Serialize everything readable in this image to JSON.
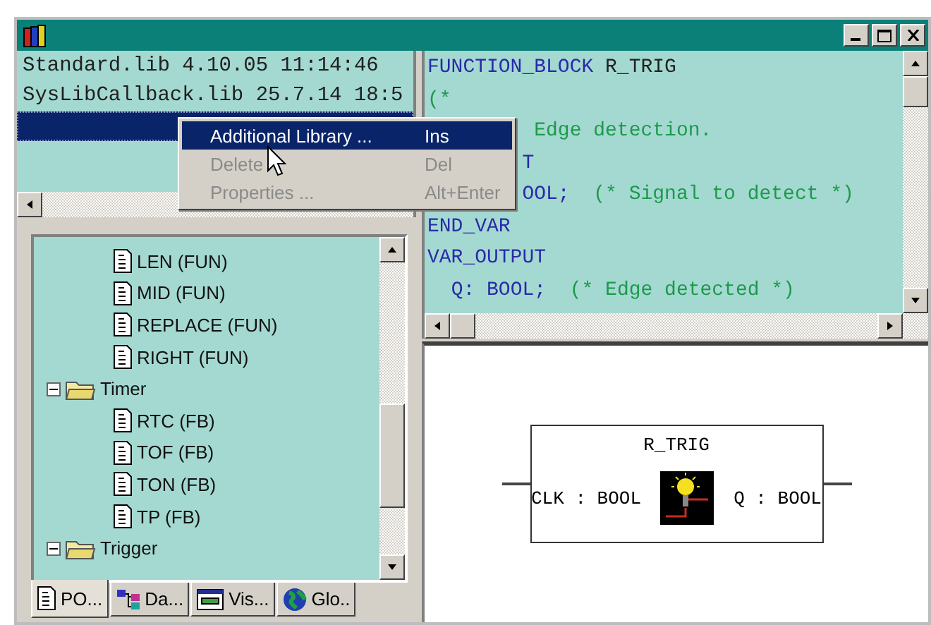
{
  "library_list": {
    "rows": [
      {
        "label": "Standard.lib 4.10.05 11:14:46",
        "selected": false
      },
      {
        "label": "SysLibCallback.lib 25.7.14 18:5",
        "selected": false
      },
      {
        "selected": true
      }
    ]
  },
  "context_menu": {
    "items": [
      {
        "label": "Additional Library ...",
        "shortcut": "Ins",
        "selected": true,
        "disabled": false
      },
      {
        "label": "Delete",
        "shortcut": "Del",
        "selected": false,
        "disabled": true
      },
      {
        "label": "Properties ...",
        "shortcut": "Alt+Enter",
        "selected": false,
        "disabled": true
      }
    ]
  },
  "tree": {
    "items": [
      {
        "label": "LEN (FUN)",
        "kind": "pou"
      },
      {
        "label": "MID (FUN)",
        "kind": "pou"
      },
      {
        "label": "REPLACE (FUN)",
        "kind": "pou"
      },
      {
        "label": "RIGHT (FUN)",
        "kind": "pou"
      },
      {
        "label": "Timer",
        "kind": "folder",
        "expanded": true,
        "children": [
          {
            "label": "RTC (FB)",
            "kind": "pou"
          },
          {
            "label": "TOF (FB)",
            "kind": "pou"
          },
          {
            "label": "TON (FB)",
            "kind": "pou"
          },
          {
            "label": "TP (FB)",
            "kind": "pou"
          }
        ]
      },
      {
        "label": "Trigger",
        "kind": "folder",
        "expanded": true
      }
    ]
  },
  "tabs": [
    {
      "label": "PO...",
      "kind": "pou",
      "selected": true
    },
    {
      "label": "Da...",
      "kind": "data",
      "selected": false
    },
    {
      "label": "Vis...",
      "kind": "vis",
      "selected": false
    },
    {
      "label": "Glo..",
      "kind": "globe",
      "selected": false
    }
  ],
  "code": {
    "lines": [
      [
        {
          "text": "FUNCTION_BLOCK",
          "kind": "keyword"
        },
        {
          "text": " R_TRIG",
          "kind": "plain"
        }
      ],
      [
        {
          "text": "(*",
          "kind": "comment"
        }
      ],
      [
        {
          "text": "         Edge detection.",
          "kind": "comment"
        }
      ],
      [
        {
          "text": "        T",
          "kind": "keyword"
        }
      ],
      [
        {
          "text": "        OOL;",
          "kind": "keyword"
        },
        {
          "text": "  (* Signal to detect *)",
          "kind": "comment"
        }
      ],
      [
        {
          "text": "END_VAR",
          "kind": "keyword"
        }
      ],
      [
        {
          "text": "VAR_OUTPUT",
          "kind": "keyword"
        }
      ],
      [
        {
          "text": "  Q: BOOL;",
          "kind": "keyword"
        },
        {
          "text": "  (* Edge detected *)",
          "kind": "comment"
        }
      ]
    ]
  },
  "block": {
    "title": "R_TRIG",
    "input": "CLK : BOOL",
    "output": "Q : BOOL"
  }
}
